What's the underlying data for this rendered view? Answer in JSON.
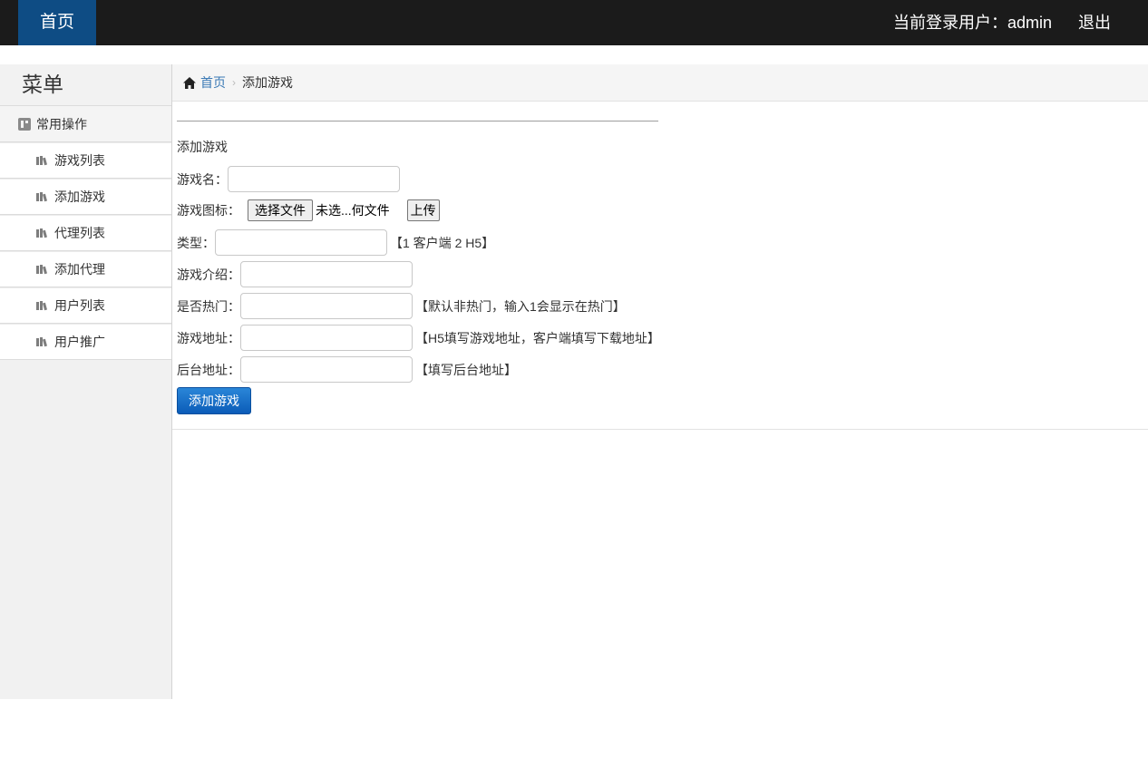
{
  "topbar": {
    "home_label": "首页",
    "user_info": "当前登录用户：admin",
    "logout_label": "退出"
  },
  "sidebar": {
    "title": "菜单",
    "section_label": "常用操作",
    "items": [
      {
        "label": "游戏列表"
      },
      {
        "label": "添加游戏"
      },
      {
        "label": "代理列表"
      },
      {
        "label": "添加代理"
      },
      {
        "label": "用户列表"
      },
      {
        "label": "用户推广"
      }
    ]
  },
  "breadcrumb": {
    "home": "首页",
    "current": "添加游戏"
  },
  "form": {
    "title": "添加游戏",
    "game_name_label": "游戏名：",
    "game_name_value": "",
    "game_icon_label": "游戏图标：",
    "file_button_label": "选择文件",
    "file_status": "未选...何文件",
    "upload_label": "上传",
    "type_label": "类型：",
    "type_value": "",
    "type_hint": "【1 客户端 2 H5】",
    "intro_label": "游戏介绍：",
    "intro_value": "",
    "hot_label": "是否热门：",
    "hot_value": "",
    "hot_hint": "【默认非热门，输入1会显示在热门】",
    "address_label": "游戏地址：",
    "address_value": "",
    "address_hint": "【H5填写游戏地址，客户端填写下载地址】",
    "backend_label": "后台地址：",
    "backend_value": "",
    "backend_hint": "【填写后台地址】",
    "submit_label": "添加游戏"
  },
  "colors": {
    "topbar_bg": "#1b1b1b",
    "home_active_bg": "#0e4c84",
    "link": "#3a79b5",
    "primary_button": "#0b5cb8"
  }
}
